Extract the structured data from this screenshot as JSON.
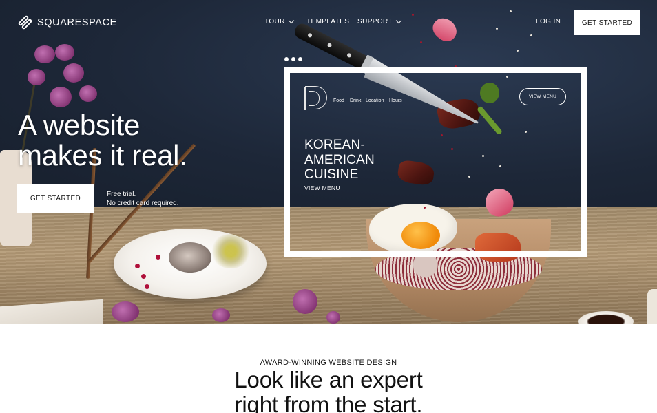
{
  "brand": {
    "name": "SQUARESPACE"
  },
  "nav": {
    "items": [
      {
        "label": "TOUR",
        "has_dropdown": true
      },
      {
        "label": "TEMPLATES",
        "has_dropdown": false
      },
      {
        "label": "SUPPORT",
        "has_dropdown": true
      }
    ],
    "login_label": "LOG IN",
    "cta_label": "GET STARTED"
  },
  "hero": {
    "headline_line1": "A website",
    "headline_line2": "makes it real.",
    "cta_label": "GET STARTED",
    "trial_line1": "Free trial.",
    "trial_line2": "No credit card required."
  },
  "preview": {
    "nav_items": [
      "Food",
      "Drink",
      "Location",
      "Hours"
    ],
    "button_label": "VIEW MENU",
    "title_line1": "KOREAN-",
    "title_line2": "AMERICAN",
    "title_line3": "CUISINE",
    "link_label": "VIEW MENU"
  },
  "section": {
    "eyebrow": "AWARD-WINNING WEBSITE DESIGN",
    "heading_line1": "Look like an expert",
    "heading_line2": "right from the start."
  },
  "colors": {
    "wall": "#1d2738",
    "white": "#ffffff",
    "text": "#111111"
  }
}
